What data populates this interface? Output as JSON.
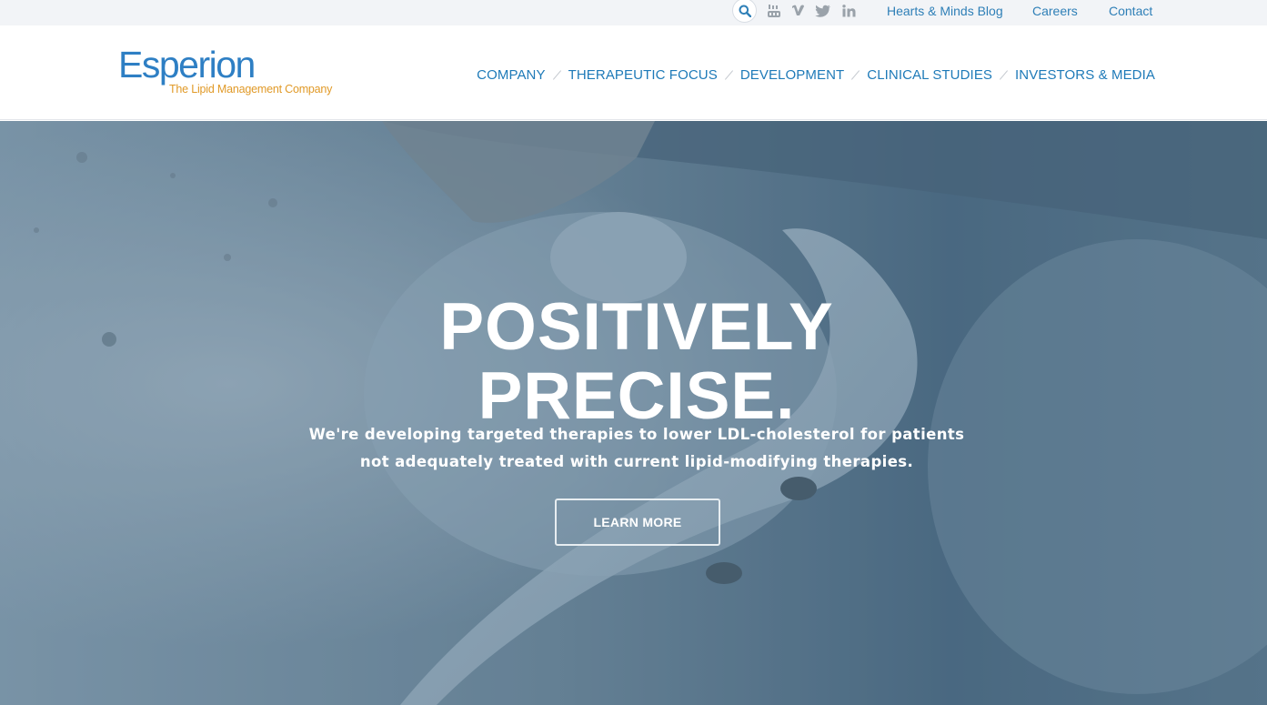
{
  "utility": {
    "icons": [
      "search-icon",
      "youtube-icon",
      "vimeo-icon",
      "twitter-icon",
      "linkedin-icon"
    ],
    "links": [
      "Hearts & Minds Blog",
      "Careers",
      "Contact"
    ]
  },
  "logo": {
    "wordmark": "Esperion",
    "tagline": "The Lipid Management Company"
  },
  "nav": {
    "items": [
      "COMPANY",
      "THERAPEUTIC FOCUS",
      "DEVELOPMENT",
      "CLINICAL STUDIES",
      "INVESTORS & MEDIA"
    ]
  },
  "hero": {
    "title_line1": "POSITIVELY",
    "title_line2": "PRECISE.",
    "subtitle_line1": "We're developing targeted therapies to lower LDL-cholesterol for patients",
    "subtitle_line2": "not adequately treated with current lipid-modifying therapies.",
    "cta_label": "LEARN MORE"
  },
  "colors": {
    "brand_blue": "#2e7fc4",
    "brand_orange": "#e19a28",
    "nav_blue": "#1e7ab8",
    "utility_bg": "#f2f4f7",
    "hero_tint": "#6f8a9c"
  }
}
